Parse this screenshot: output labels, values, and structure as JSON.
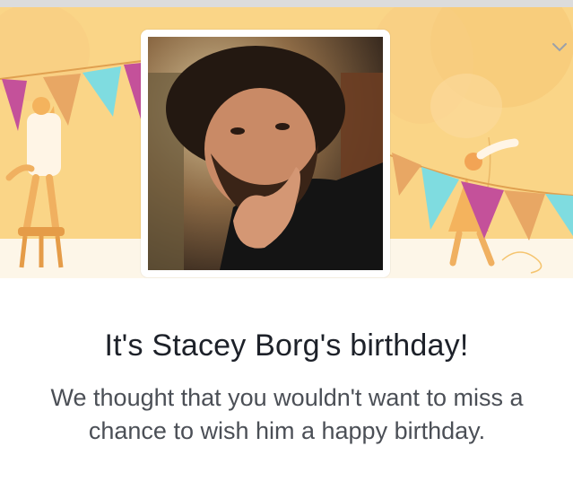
{
  "birthday_card": {
    "title": "It's Stacey Borg's birthday!",
    "message": "We thought that you wouldn't want to miss a chance to wish him a happy birthday.",
    "photo_icon": "profile-photo"
  },
  "colors": {
    "banner_bg": "#fad587",
    "flag_pink": "#c4519a",
    "flag_cyan": "#7fdce0",
    "flag_orange": "#e8a764",
    "title_text": "#1d2129",
    "body_text": "#4b4f56"
  },
  "icons": [
    "chevron-down-icon"
  ]
}
